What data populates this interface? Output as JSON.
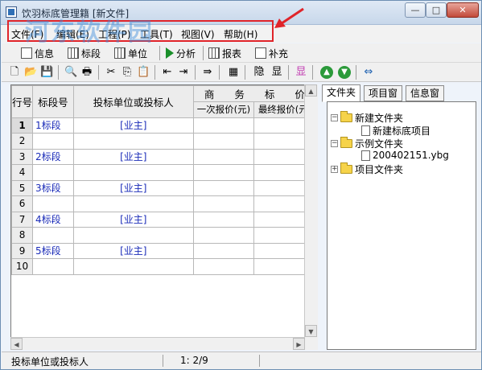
{
  "window": {
    "title": "饮羽标底管理籍 [新文件]",
    "min_label": "—",
    "max_label": "□",
    "close_label": "✕"
  },
  "watermark": "河东软件园",
  "menu": {
    "items": [
      {
        "label": "文件(F)"
      },
      {
        "label": "编辑(E)"
      },
      {
        "label": "工程(P)"
      },
      {
        "label": "工具(T)"
      },
      {
        "label": "视图(V)"
      },
      {
        "label": "帮助(H)"
      }
    ]
  },
  "toolbar1": {
    "info": "信息",
    "segment": "标段",
    "unit": "单位",
    "analysis": "分析",
    "report": "报表",
    "supplement": "补充"
  },
  "toolbar2": {
    "hide": "隐",
    "show": "显",
    "show2": "显"
  },
  "grid": {
    "headers": {
      "row": "行号",
      "segment": "标段号",
      "bidder": "投标单位或投标人",
      "business": "商　　务　　标　　价",
      "first_quote": "一次报价(元)",
      "final_quote": "最终报价(元)"
    },
    "rows": [
      {
        "num": "1",
        "segment": "1标段",
        "bidder": "[业主]"
      },
      {
        "num": "2",
        "segment": "",
        "bidder": ""
      },
      {
        "num": "3",
        "segment": "2标段",
        "bidder": "[业主]"
      },
      {
        "num": "4",
        "segment": "",
        "bidder": ""
      },
      {
        "num": "5",
        "segment": "3标段",
        "bidder": "[业主]"
      },
      {
        "num": "6",
        "segment": "",
        "bidder": ""
      },
      {
        "num": "7",
        "segment": "4标段",
        "bidder": "[业主]"
      },
      {
        "num": "8",
        "segment": "",
        "bidder": ""
      },
      {
        "num": "9",
        "segment": "5标段",
        "bidder": "[业主]"
      },
      {
        "num": "10",
        "segment": "",
        "bidder": ""
      }
    ]
  },
  "right_panel": {
    "tabs": [
      {
        "label": "文件夹"
      },
      {
        "label": "项目窗"
      },
      {
        "label": "信息窗"
      }
    ],
    "tree": {
      "folder1": "新建文件夹",
      "item1": "新建标底项目",
      "folder2": "示例文件夹",
      "item2": "200402151.ybg",
      "folder3": "项目文件夹"
    }
  },
  "status": {
    "left": "投标单位或投标人",
    "position": "1: 2/9"
  },
  "colors": {
    "highlight_border": "#e0242a",
    "link_blue": "#1a2bb8",
    "folder_yellow": "#f6d34a"
  }
}
